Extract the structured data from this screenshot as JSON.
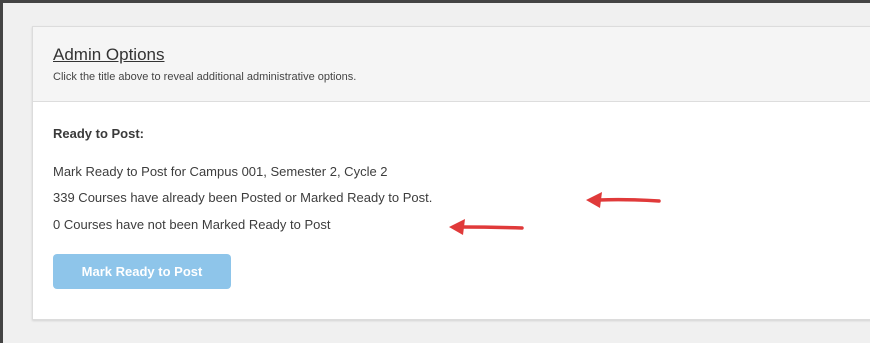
{
  "admin_options": {
    "title": "Admin Options",
    "subtitle": "Click the title above to reveal additional administrative options."
  },
  "ready_to_post": {
    "heading": "Ready to Post:",
    "lines": [
      "Mark Ready to Post for Campus 001, Semester 2, Cycle 2",
      "339 Courses have already been Posted or Marked Ready to Post.",
      "0 Courses have not been Marked Ready to Post"
    ],
    "button_label": "Mark Ready to Post"
  },
  "colors": {
    "button": "#8ec5ea",
    "annotation_arrow": "#e03a3a",
    "header_background": "#f5f5f5"
  },
  "icons": {
    "annotation": "left-arrow-icon"
  }
}
